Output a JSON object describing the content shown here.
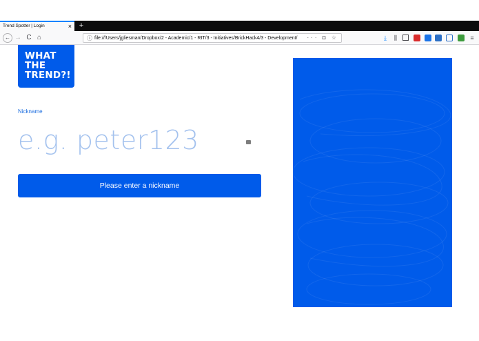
{
  "browser": {
    "tab_title": "Trend Spotter | Login",
    "tab_close": "×",
    "new_tab": "+",
    "url": "file:///Users/jgliesman/Dropbox/2 - Academic/1 - RIT/3 - Initiatives/BrickHack4/3 - Development/",
    "url_actions": "··· ◘ ☆",
    "icons": [
      "back-arrow-icon",
      "forward-arrow-icon",
      "reload-icon",
      "home-icon",
      "download-icon",
      "library-icon",
      "sidebar-icon",
      "extension-icons",
      "menu-icon"
    ]
  },
  "logo": {
    "lines": [
      "WHAT",
      "THE",
      "TREND?!"
    ]
  },
  "form": {
    "label": "Nickname",
    "placeholder": "e.g. peter123",
    "button_label": "Please enter a nickname"
  },
  "colors": {
    "brand_blue": "#005bea",
    "label_blue": "#1f6fe0",
    "placeholder_blue": "#a4c2ee"
  }
}
